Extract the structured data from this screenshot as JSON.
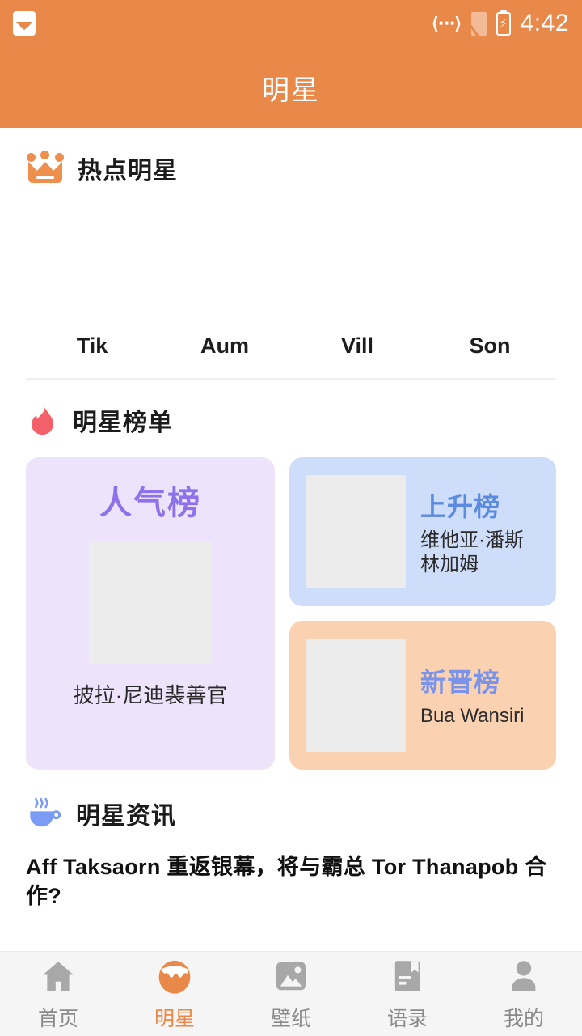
{
  "statusbar": {
    "photo_icon": "image-icon",
    "dev_icon": "developer-mode-icon",
    "sim_icon": "sim-off-icon",
    "battery_icon": "battery-charging-icon",
    "time": "4:42"
  },
  "appbar": {
    "title": "明星"
  },
  "hot_stars": {
    "icon": "crown-icon",
    "title": "热点明星",
    "items": [
      {
        "name": "Tik"
      },
      {
        "name": "Aum"
      },
      {
        "name": "Vill"
      },
      {
        "name": "Son"
      }
    ]
  },
  "rankings": {
    "icon": "flame-icon",
    "title": "明星榜单",
    "popularity": {
      "title": "人气榜",
      "name": "披拉·尼迪裴善官"
    },
    "rising": {
      "title": "上升榜",
      "name": "维他亚·潘斯林加姆"
    },
    "newcomer": {
      "title": "新晋榜",
      "name": "Bua Wansiri"
    }
  },
  "news": {
    "icon": "coffee-icon",
    "title": "明星资讯",
    "items": [
      {
        "headline": "Aff Taksaorn 重返银幕，将与霸总 Tor Thanapob 合作?"
      }
    ]
  },
  "bottomnav": {
    "items": [
      {
        "label": "首页",
        "icon": "home-icon"
      },
      {
        "label": "明星",
        "icon": "star-face-icon"
      },
      {
        "label": "壁纸",
        "icon": "wallpaper-icon"
      },
      {
        "label": "语录",
        "icon": "quotes-book-icon"
      },
      {
        "label": "我的",
        "icon": "profile-icon"
      }
    ],
    "active_index": 1
  },
  "colors": {
    "brand_orange": "#E8894A",
    "popularity_bg": "#EDE3FB",
    "popularity_text": "#8E72EC",
    "rising_bg": "#CEDDFA",
    "rising_text": "#5B8BE0",
    "newcomer_bg": "#FAD2B2",
    "newcomer_text": "#7B93E8",
    "flame": "#F2606A",
    "coffee": "#7B9CF5"
  }
}
